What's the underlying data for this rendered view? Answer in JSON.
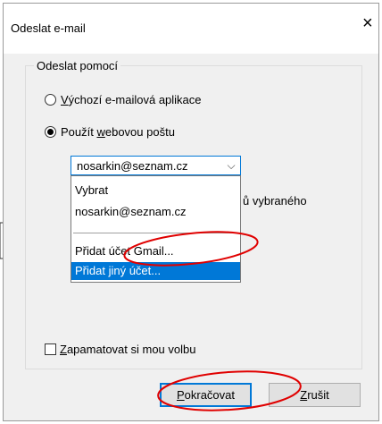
{
  "dialog": {
    "title": "Odeslat e-mail",
    "close_glyph": "×"
  },
  "group": {
    "legend": "Odeslat pomocí",
    "options": [
      {
        "underline_char": "V",
        "rest": "ýchozí e-mailová aplikace",
        "checked": false
      },
      {
        "prefix": "Použít ",
        "underline_char": "w",
        "rest": "ebovou poštu",
        "checked": true
      }
    ]
  },
  "combo": {
    "value": "nosarkin@seznam.cz",
    "arrow_glyph": "⌵"
  },
  "dropdown": {
    "items": [
      {
        "label": "Vybrat",
        "selected": false
      },
      {
        "label": "nosarkin@seznam.cz",
        "selected": false
      },
      {
        "label": "Přidat účet Gmail...",
        "selected": false
      },
      {
        "label": "Přidat jiný účet...",
        "selected": true
      }
    ]
  },
  "partially_hidden_text": "ů vybraného",
  "remember": {
    "underline_char": "Z",
    "rest": "apamatovat si mou volbu",
    "checked": false
  },
  "buttons": {
    "continue_underline": "P",
    "continue_rest": "okračovat",
    "cancel_underline": "Z",
    "cancel_rest": "rušit"
  },
  "colors": {
    "accent": "#0078d7",
    "annotation": "#e00000"
  }
}
